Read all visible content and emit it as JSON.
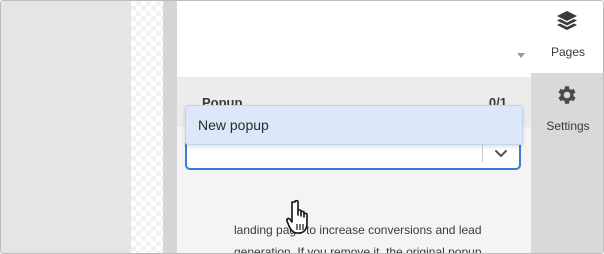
{
  "popup": {
    "title": "Popup",
    "count": "0/1",
    "select_value": "",
    "dropdown_options": [
      "New popup"
    ],
    "description_lines": [
      "landing page to increase conversions and lead",
      "generation. If you remove it, the original popup"
    ]
  },
  "sidebar": {
    "items": [
      {
        "label": "Pages",
        "icon": "layers-icon",
        "active": true
      },
      {
        "label": "Settings",
        "icon": "gear-icon",
        "active": false
      }
    ]
  },
  "colors": {
    "accent": "#3a7bd5",
    "dropdown_highlight": "#dce7f9"
  }
}
